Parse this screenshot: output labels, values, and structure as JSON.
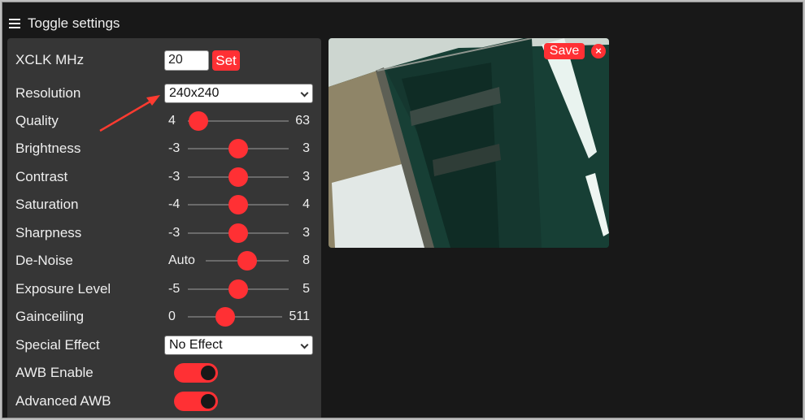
{
  "header": {
    "menu_icon": "hamburger-menu-icon",
    "title": "Toggle settings"
  },
  "settings": {
    "xclk": {
      "label": "XCLK MHz",
      "value": "20",
      "set_label": "Set"
    },
    "resolution": {
      "label": "Resolution",
      "selected": "240x240"
    },
    "quality": {
      "label": "Quality",
      "min": "4",
      "max": "63",
      "value": 10
    },
    "brightness": {
      "label": "Brightness",
      "min": "-3",
      "max": "3",
      "value": 0
    },
    "contrast": {
      "label": "Contrast",
      "min": "-3",
      "max": "3",
      "value": 0
    },
    "saturation": {
      "label": "Saturation",
      "min": "-4",
      "max": "4",
      "value": 0
    },
    "sharpness": {
      "label": "Sharpness",
      "min": "-3",
      "max": "3",
      "value": 0
    },
    "denoise": {
      "label": "De-Noise",
      "min": "Auto",
      "max": "8",
      "value": 0.5
    },
    "exposure_level": {
      "label": "Exposure Level",
      "min": "-5",
      "max": "5",
      "value": 0
    },
    "gainceiling": {
      "label": "Gainceiling",
      "min": "0",
      "max": "511",
      "value": 0.4
    },
    "special_effect": {
      "label": "Special Effect",
      "selected": "No Effect"
    },
    "awb_enable": {
      "label": "AWB Enable",
      "on": true
    },
    "advanced_awb": {
      "label": "Advanced AWB",
      "on": true
    }
  },
  "preview": {
    "save_label": "Save",
    "close_label": "×"
  },
  "colors": {
    "accent": "#ff3034",
    "panel": "#363636",
    "background": "#181818"
  }
}
